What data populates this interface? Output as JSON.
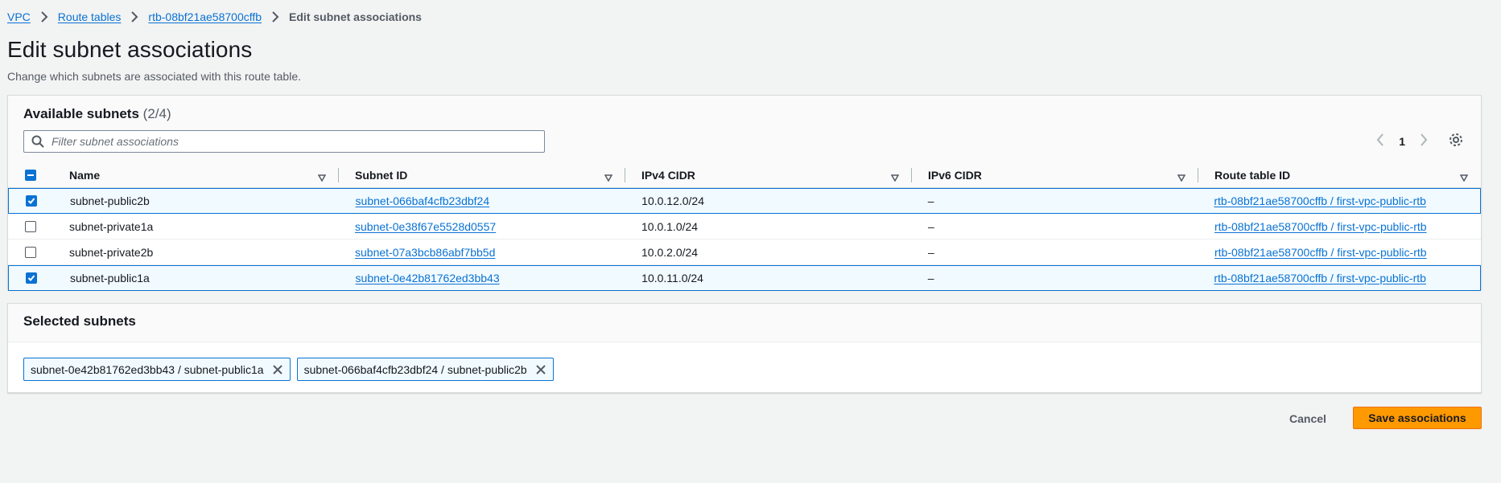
{
  "breadcrumb": {
    "items": [
      "VPC",
      "Route tables",
      "rtb-08bf21ae58700cffb"
    ],
    "current": "Edit subnet associations"
  },
  "page": {
    "title": "Edit subnet associations",
    "description": "Change which subnets are associated with this route table."
  },
  "available": {
    "title": "Available subnets",
    "count": "(2/4)",
    "filter_placeholder": "Filter subnet associations",
    "filter_value": "",
    "current_page": "1",
    "columns": [
      "Name",
      "Subnet ID",
      "IPv4 CIDR",
      "IPv6 CIDR",
      "Route table ID"
    ],
    "rows": [
      {
        "checked": true,
        "name": "subnet-public2b",
        "subnet_id": "subnet-066baf4cfb23dbf24",
        "ipv4": "10.0.12.0/24",
        "ipv6": "–",
        "route_table": "rtb-08bf21ae58700cffb / first-vpc-public-rtb"
      },
      {
        "checked": false,
        "name": "subnet-private1a",
        "subnet_id": "subnet-0e38f67e5528d0557",
        "ipv4": "10.0.1.0/24",
        "ipv6": "–",
        "route_table": "rtb-08bf21ae58700cffb / first-vpc-public-rtb"
      },
      {
        "checked": false,
        "name": "subnet-private2b",
        "subnet_id": "subnet-07a3bcb86abf7bb5d",
        "ipv4": "10.0.2.0/24",
        "ipv6": "–",
        "route_table": "rtb-08bf21ae58700cffb / first-vpc-public-rtb"
      },
      {
        "checked": true,
        "name": "subnet-public1a",
        "subnet_id": "subnet-0e42b81762ed3bb43",
        "ipv4": "10.0.11.0/24",
        "ipv6": "–",
        "route_table": "rtb-08bf21ae58700cffb / first-vpc-public-rtb"
      }
    ]
  },
  "selected": {
    "title": "Selected subnets",
    "tokens": [
      "subnet-0e42b81762ed3bb43 / subnet-public1a",
      "subnet-066baf4cfb23dbf24 / subnet-public2b"
    ]
  },
  "actions": {
    "cancel": "Cancel",
    "save": "Save associations"
  },
  "colors": {
    "link": "#0972d3",
    "primary_button": "#ff9900",
    "background": "#f2f3f3"
  }
}
